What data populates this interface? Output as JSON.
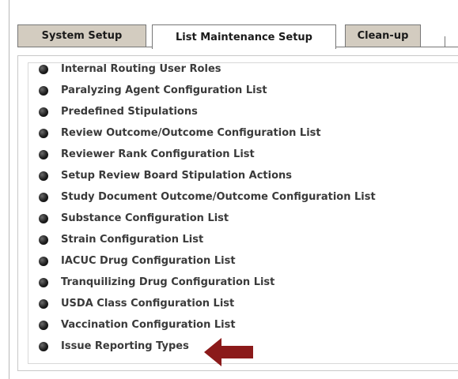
{
  "tabs": {
    "system_setup": "System Setup",
    "list_maintenance": "List Maintenance Setup",
    "cleanup": "Clean-up"
  },
  "list": {
    "items": [
      "Internal Routing User Roles",
      "Paralyzing Agent Configuration List",
      "Predefined Stipulations",
      "Review Outcome/Outcome Configuration List",
      "Reviewer Rank Configuration List",
      "Setup Review Board Stipulation Actions",
      "Study Document Outcome/Outcome Configuration List",
      "Substance Configuration List",
      "Strain Configuration List",
      "IACUC Drug Configuration List",
      "Tranquilizing Drug Configuration List",
      "USDA Class Configuration List",
      "Vaccination Configuration List",
      "Issue Reporting Types"
    ]
  },
  "colors": {
    "tab_inactive_bg": "#d3ccc0",
    "arrow": "#8b1a1a"
  },
  "icons": {
    "bullet": "bullet-icon",
    "pointer": "arrow-left-icon"
  }
}
